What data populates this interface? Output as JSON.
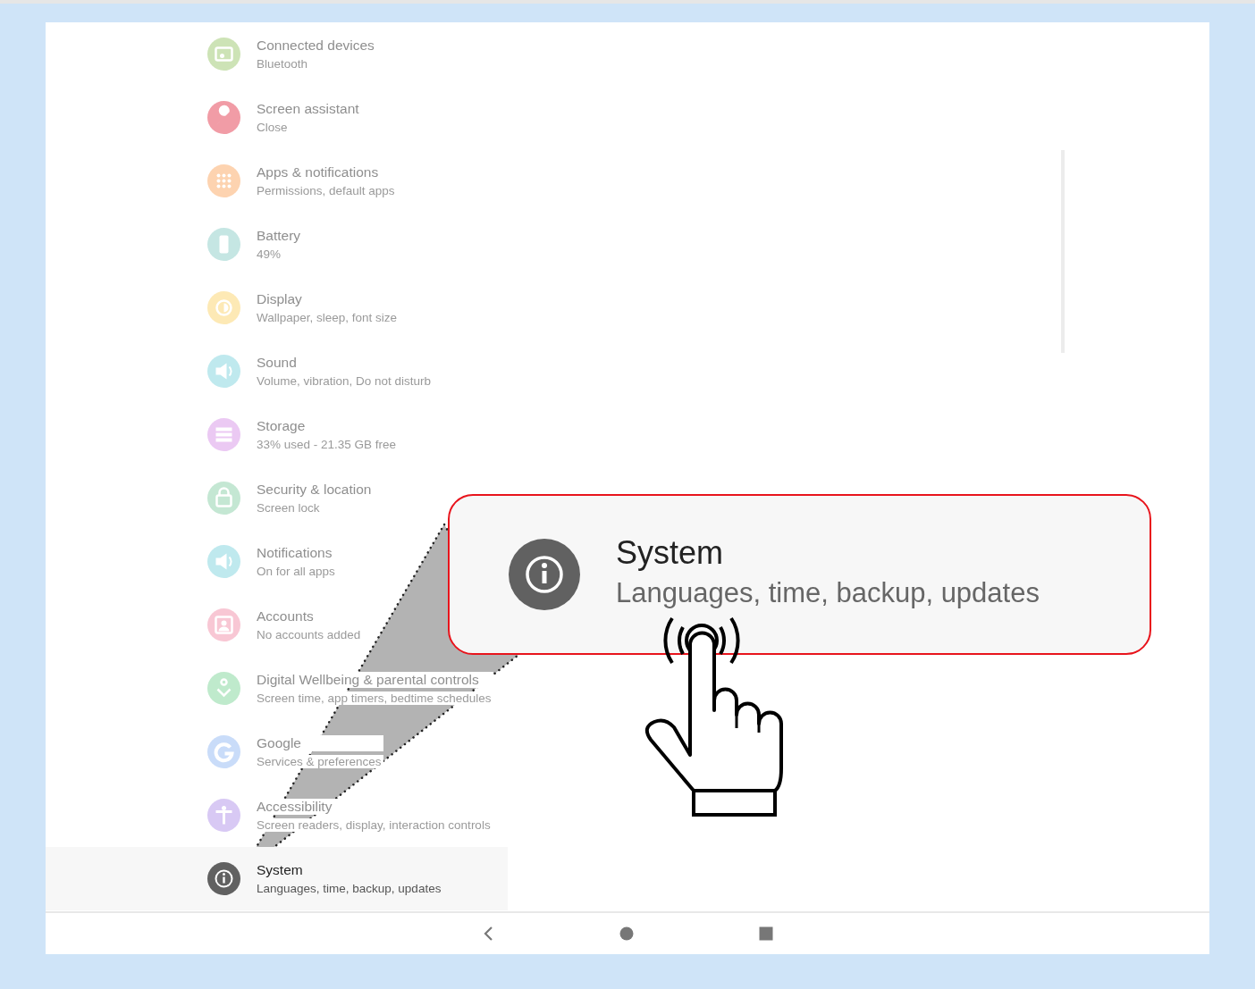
{
  "settings_list": [
    {
      "title": "Connected devices",
      "subtitle": "Bluetooth",
      "color": "#cde3b6",
      "highlighted": false
    },
    {
      "title": "Screen assistant",
      "subtitle": "Close",
      "color": "#f19ca6",
      "highlighted": false
    },
    {
      "title": "Apps & notifications",
      "subtitle": "Permissions, default apps",
      "color": "#fdd3b0",
      "highlighted": false
    },
    {
      "title": "Battery",
      "subtitle": "49%",
      "color": "#c5e6e3",
      "highlighted": false
    },
    {
      "title": "Display",
      "subtitle": "Wallpaper, sleep, font size",
      "color": "#fde9b5",
      "highlighted": false
    },
    {
      "title": "Sound",
      "subtitle": "Volume, vibration, Do not disturb",
      "color": "#bfe9ee",
      "highlighted": false
    },
    {
      "title": "Storage",
      "subtitle": "33% used - 21.35 GB free",
      "color": "#ebc9f3",
      "highlighted": false
    },
    {
      "title": "Security & location",
      "subtitle": "Screen lock",
      "color": "#c4e7d3",
      "highlighted": false
    },
    {
      "title": "Notifications",
      "subtitle": "On for all apps",
      "color": "#bfe9ee",
      "highlighted": false
    },
    {
      "title": "Accounts",
      "subtitle": "No accounts added",
      "color": "#f8c7d4",
      "highlighted": false
    },
    {
      "title": "Digital Wellbeing & parental controls",
      "subtitle": "Screen time, app timers, bedtime schedules",
      "color": "#bfeacc",
      "highlighted": false
    },
    {
      "title": "Google",
      "subtitle": "Services & preferences",
      "color": "#c9dcf9",
      "highlighted": false
    },
    {
      "title": "Accessibility",
      "subtitle": "Screen readers, display, interaction controls",
      "color": "#d8c9f4",
      "highlighted": false
    },
    {
      "title": "System",
      "subtitle": "Languages, time, backup, updates",
      "color": "#616161",
      "highlighted": true
    }
  ],
  "callout": {
    "title": "System",
    "subtitle": "Languages, time, backup, updates"
  }
}
